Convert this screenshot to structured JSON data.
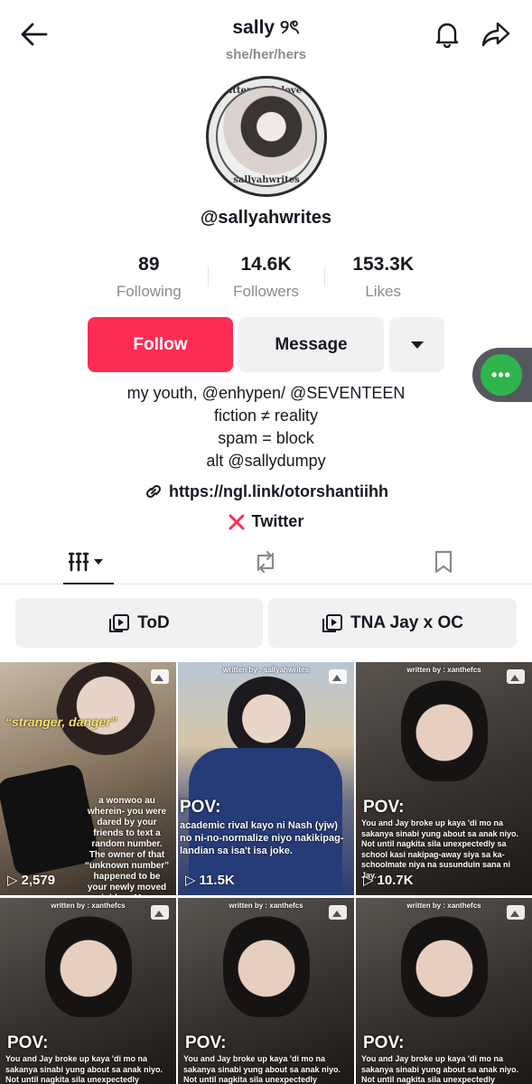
{
  "header": {
    "title": "sally ୨ৎ",
    "pronouns": "she/her/hers"
  },
  "avatar": {
    "top_text": "written with love by",
    "bottom_text": "sallyahwrites"
  },
  "profile": {
    "username": "@sallyahwrites"
  },
  "stats": [
    {
      "value": "89",
      "label": "Following"
    },
    {
      "value": "14.6K",
      "label": "Followers"
    },
    {
      "value": "153.3K",
      "label": "Likes"
    }
  ],
  "actions": {
    "follow": "Follow",
    "message": "Message",
    "floating": "•••"
  },
  "bio": {
    "line1": "my youth, @enhypen/ @SEVENTEEN",
    "line2": "fiction ≠ reality",
    "line3": "spam = block",
    "line4": "alt @sallydumpy",
    "link": "https://ngl.link/otorshantiihh",
    "twitter": "Twitter"
  },
  "playlists": [
    {
      "label": "ToD"
    },
    {
      "label": "TNA Jay x OC"
    }
  ],
  "videos": [
    {
      "overlay": "“stranger, danger”",
      "caption": "a wonwoo au wherein- you were dared by your friends to text a random number. The owner of that “unknown number” happened to be your newly moved neighbor, Marco.",
      "views": "2,579"
    },
    {
      "credit": "written by : sallyahwrites",
      "pov": "POV:",
      "caption": "academic rival kayo ni Nash (yjw) no ni-no-normalize niyo nakikipag-landian sa isa't isa joke.",
      "views": "11.5K"
    },
    {
      "credit": "written by : xanthefcs",
      "pov": "POV:",
      "caption": "You and Jay broke up kaya 'di mo na sakanya sinabi yung about sa anak niyo. Not until nagkita sila unexpectedly sa school kasi nakipag-away siya sa ka-schoolmate niya na susunduin sana ni Jay.",
      "views": "10.7K"
    },
    {
      "credit": "written by : xanthefcs",
      "pov": "POV:",
      "caption": "You and Jay broke up kaya 'di mo na sakanya sinabi yung about sa anak niyo. Not until nagkita sila unexpectedly"
    },
    {
      "credit": "written by : xanthefcs",
      "pov": "POV:",
      "caption": "You and Jay broke up kaya 'di mo na sakanya sinabi yung about sa anak niyo. Not until nagkita sila unexpectedly"
    },
    {
      "credit": "written by : xanthefcs",
      "pov": "POV:",
      "caption": "You and Jay broke up kaya 'di mo na sakanya sinabi yung about sa anak niyo. Not until nagkita sila unexpectedly"
    }
  ]
}
